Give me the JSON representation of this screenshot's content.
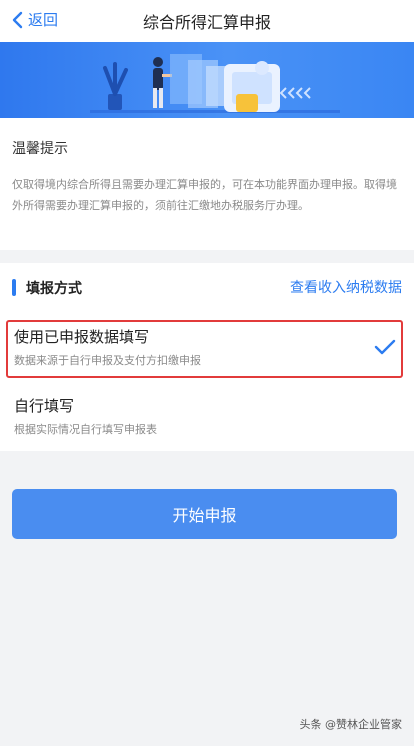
{
  "header": {
    "back_label": "返回",
    "title": "综合所得汇算申报"
  },
  "notice": {
    "title": "温馨提示",
    "text": "仅取得境内综合所得且需要办理汇算申报的，可在本功能界面办理申报。取得境外所得需要办理汇算申报的，须前往汇缴地办税服务厅办理。"
  },
  "fill_method": {
    "title": "填报方式",
    "view_data_link": "查看收入纳税数据",
    "options": [
      {
        "title": "使用已申报数据填写",
        "subtitle": "数据来源于自行申报及支付方扣缴申报",
        "selected": true
      },
      {
        "title": "自行填写",
        "subtitle": "根据实际情况自行填写申报表",
        "selected": false
      }
    ]
  },
  "start_button": "开始申报",
  "watermark": "头条 @赞林企业管家",
  "colors": {
    "accent": "#2c7cf0",
    "button": "#4a8df0",
    "highlight_border": "#e23b3b",
    "banner": "#3a86f3"
  },
  "icons": [
    "chevron-left-icon",
    "checkmark-icon",
    "banner-illustration"
  ]
}
